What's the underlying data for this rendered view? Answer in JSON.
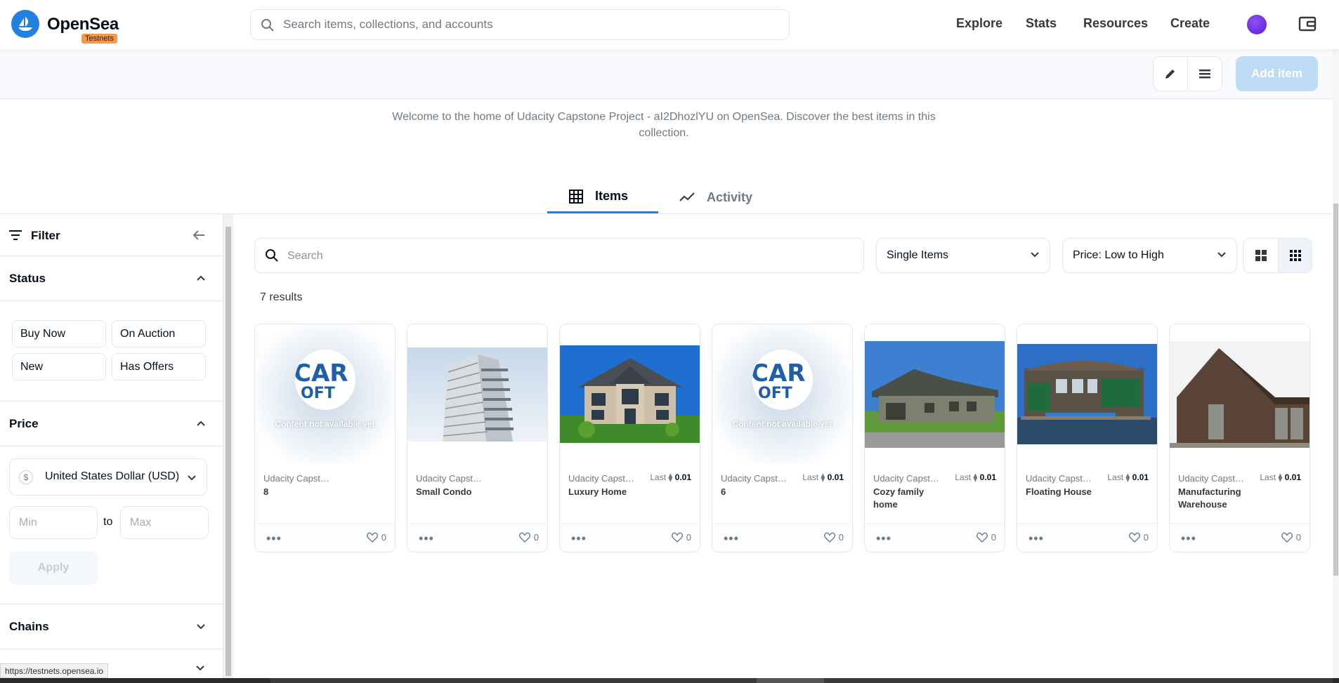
{
  "nav": {
    "brand": "OpenSea",
    "badge": "Testnets",
    "search_placeholder": "Search items, collections, and accounts",
    "links": [
      "Explore",
      "Stats",
      "Resources",
      "Create"
    ]
  },
  "toolbar": {
    "add_item_label": "Add item"
  },
  "collection": {
    "description": "Welcome to the home of Udacity Capstone Project - aI2DhozlYU on OpenSea. Discover the best items in this collection."
  },
  "tabs": [
    {
      "label": "Items",
      "icon": "grid-icon",
      "active": true
    },
    {
      "label": "Activity",
      "icon": "activity-icon",
      "active": false
    }
  ],
  "filter": {
    "title": "Filter",
    "status": {
      "title": "Status",
      "chips": [
        "Buy Now",
        "On Auction",
        "New",
        "Has Offers"
      ]
    },
    "price": {
      "title": "Price",
      "currency_symbol": "$",
      "currency": "United States Dollar (USD)",
      "min_placeholder": "Min",
      "to_label": "to",
      "max_placeholder": "Max",
      "apply_label": "Apply"
    },
    "chains": {
      "title": "Chains"
    }
  },
  "main": {
    "search_placeholder": "Search",
    "type_select": "Single Items",
    "sort_select": "Price: Low to High",
    "results": "7 results"
  },
  "items": [
    {
      "collection": "Udacity Capstone Project",
      "name": "8",
      "last_label": "",
      "last_price": "",
      "likes": "0",
      "image": "placeholder"
    },
    {
      "collection": "Udacity Capstone Project",
      "name": "Small Condo",
      "last_label": "",
      "last_price": "",
      "likes": "0",
      "image": "condo"
    },
    {
      "collection": "Udacity Capstone Project",
      "name": "Luxury Home",
      "last_label": "Last",
      "last_price": "0.01",
      "likes": "0",
      "image": "luxury"
    },
    {
      "collection": "Udacity Capstone Project",
      "name": "6",
      "last_label": "Last",
      "last_price": "0.01",
      "likes": "0",
      "image": "placeholder"
    },
    {
      "collection": "Udacity Capstone Project",
      "name": "Cozy family home",
      "last_label": "Last",
      "last_price": "0.01",
      "likes": "0",
      "image": "cozy"
    },
    {
      "collection": "Udacity Capstone Project",
      "name": "Floating House",
      "last_label": "Last",
      "last_price": "0.01",
      "likes": "0",
      "image": "floating"
    },
    {
      "collection": "Udacity Capstone Project",
      "name": "Manufacturing Warehouse",
      "last_label": "Last",
      "last_price": "0.01",
      "likes": "0",
      "image": "warehouse"
    }
  ],
  "placeholder_text": {
    "logo_top": "CAR",
    "logo_bottom": "OFT",
    "message": "Content not available yet"
  },
  "status_url": "https://testnets.opensea.io",
  "colors": {
    "accent": "#2081e2",
    "badge": "#f2994a",
    "avatar": "#6a2de8"
  }
}
